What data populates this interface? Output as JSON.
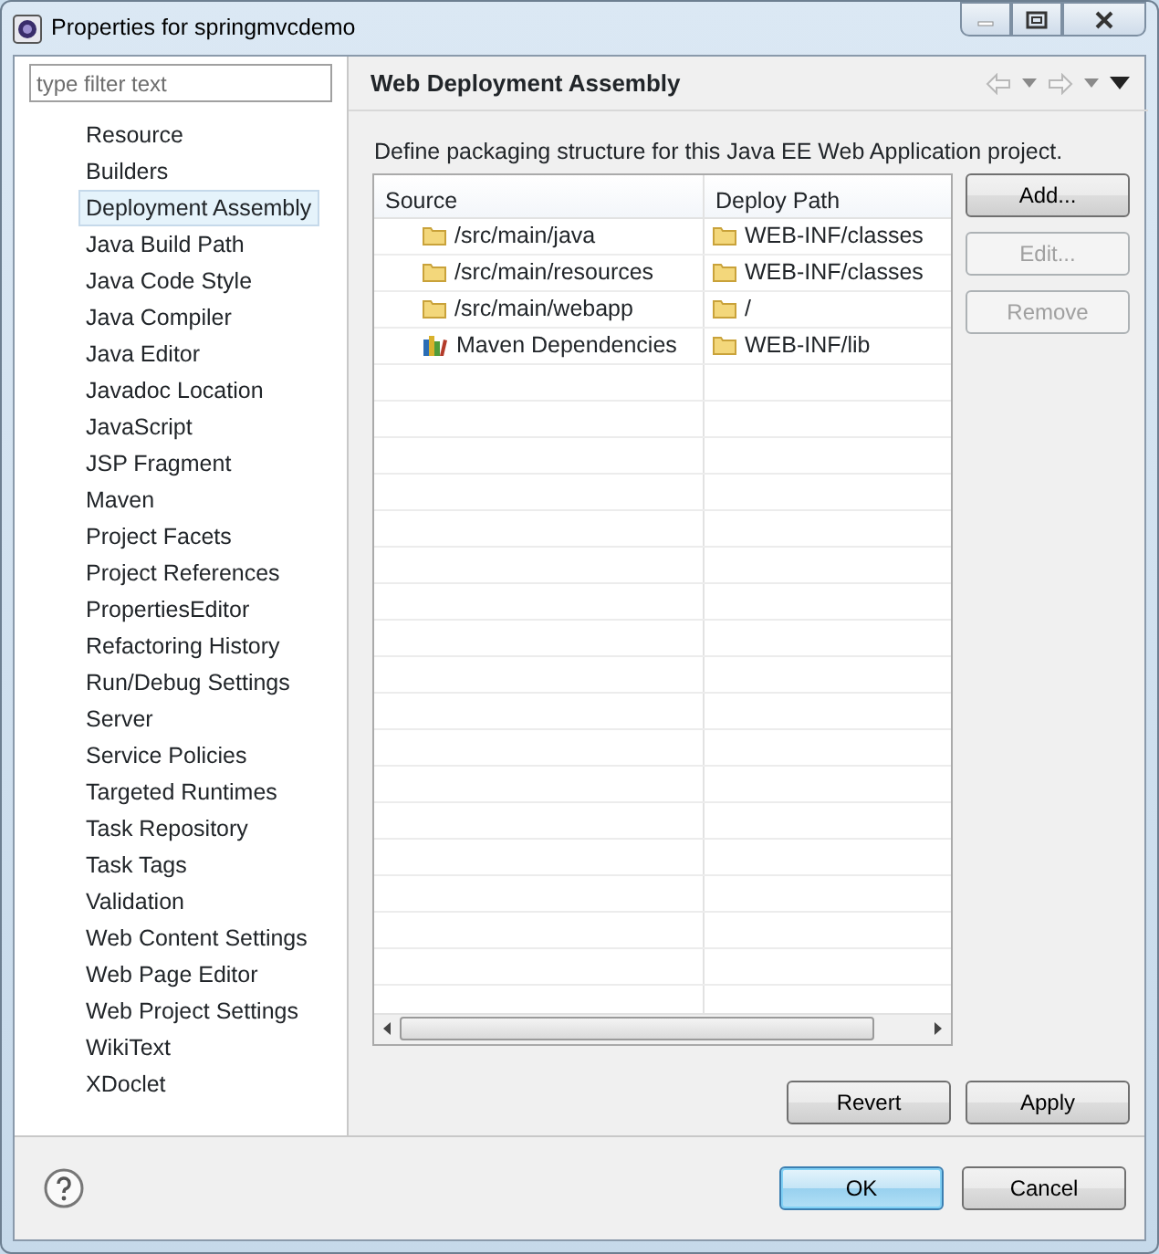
{
  "window": {
    "title": "Properties for springmvcdemo"
  },
  "filter": {
    "placeholder": "type filter text"
  },
  "nav_items": [
    {
      "label": "Resource",
      "selected": false
    },
    {
      "label": "Builders",
      "selected": false
    },
    {
      "label": "Deployment Assembly",
      "selected": true
    },
    {
      "label": "Java Build Path",
      "selected": false
    },
    {
      "label": "Java Code Style",
      "selected": false
    },
    {
      "label": "Java Compiler",
      "selected": false
    },
    {
      "label": "Java Editor",
      "selected": false
    },
    {
      "label": "Javadoc Location",
      "selected": false
    },
    {
      "label": "JavaScript",
      "selected": false
    },
    {
      "label": "JSP Fragment",
      "selected": false
    },
    {
      "label": "Maven",
      "selected": false
    },
    {
      "label": "Project Facets",
      "selected": false
    },
    {
      "label": "Project References",
      "selected": false
    },
    {
      "label": "PropertiesEditor",
      "selected": false
    },
    {
      "label": "Refactoring History",
      "selected": false
    },
    {
      "label": "Run/Debug Settings",
      "selected": false
    },
    {
      "label": "Server",
      "selected": false
    },
    {
      "label": "Service Policies",
      "selected": false
    },
    {
      "label": "Targeted Runtimes",
      "selected": false
    },
    {
      "label": "Task Repository",
      "selected": false
    },
    {
      "label": "Task Tags",
      "selected": false
    },
    {
      "label": "Validation",
      "selected": false
    },
    {
      "label": "Web Content Settings",
      "selected": false
    },
    {
      "label": "Web Page Editor",
      "selected": false
    },
    {
      "label": "Web Project Settings",
      "selected": false
    },
    {
      "label": "WikiText",
      "selected": false
    },
    {
      "label": "XDoclet",
      "selected": false
    }
  ],
  "page": {
    "title": "Web Deployment Assembly",
    "description": "Define packaging structure for this Java EE Web Application project."
  },
  "table": {
    "columns": [
      "Source",
      "Deploy Path"
    ],
    "rows": [
      {
        "kind": "folder",
        "source": "/src/main/java",
        "path": "WEB-INF/classes"
      },
      {
        "kind": "folder",
        "source": "/src/main/resources",
        "path": "WEB-INF/classes"
      },
      {
        "kind": "folder",
        "source": "/src/main/webapp",
        "path": "/"
      },
      {
        "kind": "library",
        "source": "Maven Dependencies",
        "path": "WEB-INF/lib"
      }
    ]
  },
  "side_buttons": [
    {
      "label": "Add...",
      "disabled": false
    },
    {
      "label": "Edit...",
      "disabled": true
    },
    {
      "label": "Remove",
      "disabled": true
    }
  ],
  "page_buttons": [
    "Revert",
    "Apply"
  ],
  "dialog_buttons": [
    {
      "label": "OK",
      "default": true
    },
    {
      "label": "Cancel",
      "default": false
    }
  ]
}
